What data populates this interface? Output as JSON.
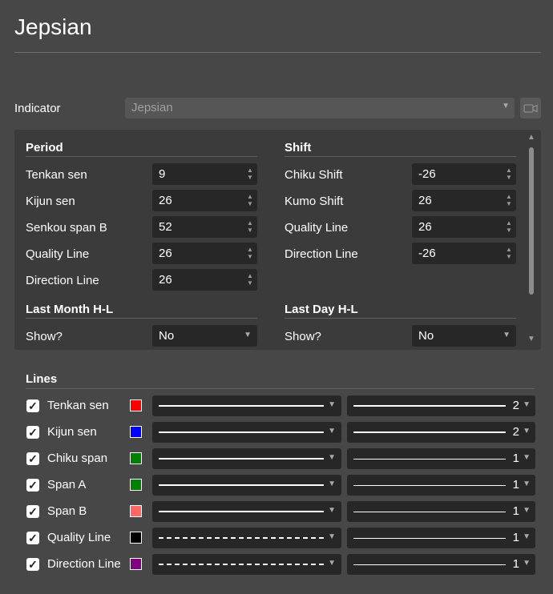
{
  "title": "Jepsian",
  "indicator": {
    "label": "Indicator",
    "value": "Jepsian",
    "camera_icon": "video-camera-icon"
  },
  "period": {
    "heading": "Period",
    "fields": [
      {
        "label": "Tenkan sen",
        "value": "9"
      },
      {
        "label": "Kijun sen",
        "value": "26"
      },
      {
        "label": "Senkou span B",
        "value": "52"
      },
      {
        "label": "Quality Line",
        "value": "26"
      },
      {
        "label": "Direction Line",
        "value": "26"
      }
    ]
  },
  "shift": {
    "heading": "Shift",
    "fields": [
      {
        "label": "Chiku Shift",
        "value": "-26"
      },
      {
        "label": "Kumo Shift",
        "value": "26"
      },
      {
        "label": "Quality Line",
        "value": "26"
      },
      {
        "label": "Direction Line",
        "value": "-26"
      }
    ]
  },
  "last_month": {
    "heading": "Last Month H-L",
    "show_label": "Show?",
    "show_value": "No"
  },
  "last_day": {
    "heading": "Last Day H-L",
    "show_label": "Show?",
    "show_value": "No"
  },
  "lines": {
    "heading": "Lines",
    "items": [
      {
        "name": "Tenkan sen",
        "color": "#ff0000",
        "style": "solid",
        "width": "2",
        "checked": true
      },
      {
        "name": "Kijun sen",
        "color": "#0000ff",
        "style": "solid",
        "width": "2",
        "checked": true
      },
      {
        "name": "Chiku span",
        "color": "#008000",
        "style": "solid",
        "width": "1",
        "checked": true
      },
      {
        "name": "Span A",
        "color": "#008000",
        "style": "solid",
        "width": "1",
        "checked": true
      },
      {
        "name": "Span B",
        "color": "#ff6666",
        "style": "solid",
        "width": "1",
        "checked": true
      },
      {
        "name": "Quality Line",
        "color": "#000000",
        "style": "dashed",
        "width": "1",
        "checked": true
      },
      {
        "name": "Direction Line",
        "color": "#800080",
        "style": "dashed",
        "width": "1",
        "checked": true
      }
    ]
  }
}
